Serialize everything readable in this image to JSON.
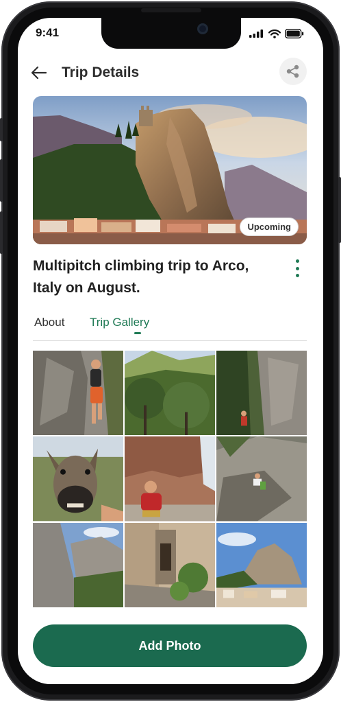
{
  "status_bar": {
    "time": "9:41"
  },
  "header": {
    "title": "Trip Details",
    "back_icon": "arrow-left-icon",
    "share_icon": "share-icon"
  },
  "hero": {
    "badge": "Upcoming"
  },
  "trip": {
    "title": "Multipitch climbing trip to Arco, Italy on August."
  },
  "tabs": [
    {
      "label": "About",
      "active": false
    },
    {
      "label": "Trip Gallery",
      "active": true
    }
  ],
  "gallery": {
    "photos": [
      "climber-on-rock-wall",
      "mountain-valley-trees",
      "climber-in-rock-corridor",
      "donkey-closeup",
      "person-in-red-jacket-under-rock",
      "climber-on-slab",
      "rock-cliff-blue-sky",
      "village-alley",
      "village-under-cliff"
    ]
  },
  "actions": {
    "add_photo_label": "Add Photo"
  },
  "colors": {
    "accent": "#1f7a55",
    "button": "#1b6a4f"
  }
}
